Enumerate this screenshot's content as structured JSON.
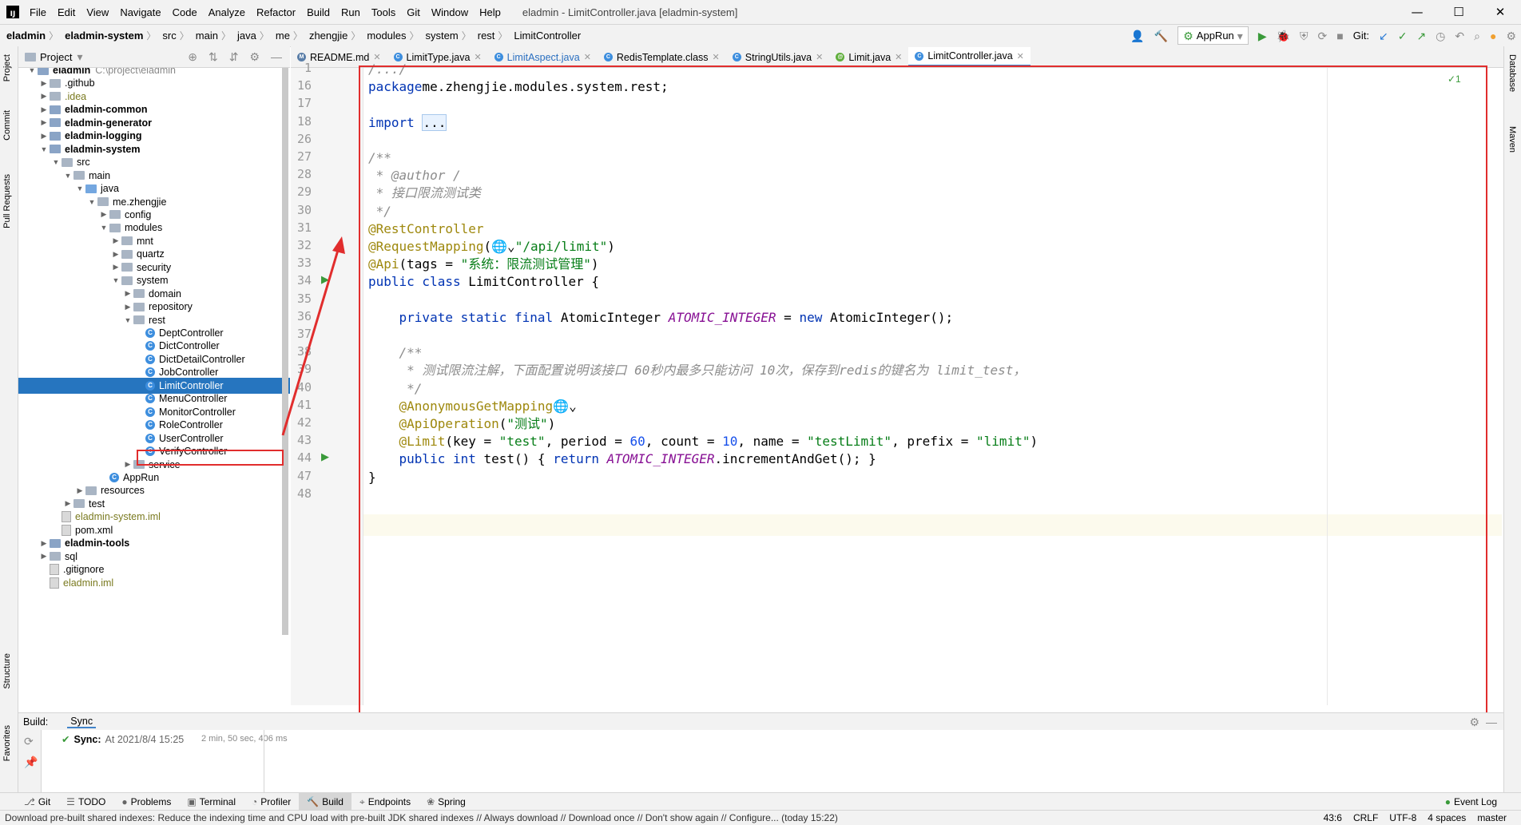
{
  "window": {
    "logo": "IJ",
    "menu": [
      "File",
      "Edit",
      "View",
      "Navigate",
      "Code",
      "Analyze",
      "Refactor",
      "Build",
      "Run",
      "Tools",
      "Git",
      "Window",
      "Help"
    ],
    "title": "eladmin - LimitController.java [eladmin-system]",
    "controls": [
      "—",
      "☐",
      "✕"
    ]
  },
  "breadcrumb": [
    "eladmin",
    "eladmin-system",
    "src",
    "main",
    "java",
    "me",
    "zhengjie",
    "modules",
    "system",
    "rest",
    "LimitController"
  ],
  "toolbar": {
    "run_config": "AppRun",
    "git_label": "Git:"
  },
  "left_stripe": [
    "Project",
    "Commit",
    "Pull Requests",
    "Structure",
    "Favorites"
  ],
  "right_stripe": [
    "Database",
    "Maven"
  ],
  "project": {
    "header": "Project",
    "tree": [
      {
        "indent": 0,
        "arrow": "▼",
        "icon": "module",
        "text": "eladmin",
        "suffix": "C:\\project\\eladmin",
        "bold": true
      },
      {
        "indent": 1,
        "arrow": "▶",
        "icon": "folder",
        "text": ".github"
      },
      {
        "indent": 1,
        "arrow": "▶",
        "icon": "folder",
        "text": ".idea",
        "style": "olive"
      },
      {
        "indent": 1,
        "arrow": "▶",
        "icon": "module",
        "text": "eladmin-common",
        "bold": true
      },
      {
        "indent": 1,
        "arrow": "▶",
        "icon": "module",
        "text": "eladmin-generator",
        "bold": true
      },
      {
        "indent": 1,
        "arrow": "▶",
        "icon": "module",
        "text": "eladmin-logging",
        "bold": true
      },
      {
        "indent": 1,
        "arrow": "▼",
        "icon": "module",
        "text": "eladmin-system",
        "bold": true
      },
      {
        "indent": 2,
        "arrow": "▼",
        "icon": "folder",
        "text": "src"
      },
      {
        "indent": 3,
        "arrow": "▼",
        "icon": "folder",
        "text": "main"
      },
      {
        "indent": 4,
        "arrow": "▼",
        "icon": "blue",
        "text": "java"
      },
      {
        "indent": 5,
        "arrow": "▼",
        "icon": "folder",
        "text": "me.zhengjie"
      },
      {
        "indent": 6,
        "arrow": "▶",
        "icon": "folder",
        "text": "config"
      },
      {
        "indent": 6,
        "arrow": "▼",
        "icon": "folder",
        "text": "modules"
      },
      {
        "indent": 7,
        "arrow": "▶",
        "icon": "folder",
        "text": "mnt"
      },
      {
        "indent": 7,
        "arrow": "▶",
        "icon": "folder",
        "text": "quartz"
      },
      {
        "indent": 7,
        "arrow": "▶",
        "icon": "folder",
        "text": "security"
      },
      {
        "indent": 7,
        "arrow": "▼",
        "icon": "folder",
        "text": "system"
      },
      {
        "indent": 8,
        "arrow": "▶",
        "icon": "folder",
        "text": "domain"
      },
      {
        "indent": 8,
        "arrow": "▶",
        "icon": "folder",
        "text": "repository"
      },
      {
        "indent": 8,
        "arrow": "▼",
        "icon": "folder",
        "text": "rest"
      },
      {
        "indent": 9,
        "arrow": "",
        "icon": "class",
        "text": "DeptController"
      },
      {
        "indent": 9,
        "arrow": "",
        "icon": "class",
        "text": "DictController"
      },
      {
        "indent": 9,
        "arrow": "",
        "icon": "class",
        "text": "DictDetailController"
      },
      {
        "indent": 9,
        "arrow": "",
        "icon": "class",
        "text": "JobController"
      },
      {
        "indent": 9,
        "arrow": "",
        "icon": "class",
        "text": "LimitController",
        "selected": true
      },
      {
        "indent": 9,
        "arrow": "",
        "icon": "class",
        "text": "MenuController"
      },
      {
        "indent": 9,
        "arrow": "",
        "icon": "class",
        "text": "MonitorController"
      },
      {
        "indent": 9,
        "arrow": "",
        "icon": "class",
        "text": "RoleController"
      },
      {
        "indent": 9,
        "arrow": "",
        "icon": "class",
        "text": "UserController"
      },
      {
        "indent": 9,
        "arrow": "",
        "icon": "class",
        "text": "VerifyController"
      },
      {
        "indent": 8,
        "arrow": "▶",
        "icon": "folder",
        "text": "service"
      },
      {
        "indent": 6,
        "arrow": "",
        "icon": "class",
        "text": "AppRun"
      },
      {
        "indent": 4,
        "arrow": "▶",
        "icon": "folder",
        "text": "resources"
      },
      {
        "indent": 3,
        "arrow": "▶",
        "icon": "folder",
        "text": "test"
      },
      {
        "indent": 2,
        "arrow": "",
        "icon": "file",
        "text": "eladmin-system.iml",
        "style": "olive"
      },
      {
        "indent": 2,
        "arrow": "",
        "icon": "file",
        "text": "pom.xml"
      },
      {
        "indent": 1,
        "arrow": "▶",
        "icon": "module",
        "text": "eladmin-tools",
        "bold": true
      },
      {
        "indent": 1,
        "arrow": "▶",
        "icon": "folder",
        "text": "sql"
      },
      {
        "indent": 1,
        "arrow": "",
        "icon": "file",
        "text": ".gitignore"
      },
      {
        "indent": 1,
        "arrow": "",
        "icon": "file",
        "text": "eladmin.iml",
        "style": "olive"
      }
    ]
  },
  "tabs": [
    {
      "label": "README.md",
      "icon": "md",
      "color": "#5a7ea8"
    },
    {
      "label": "LimitType.java",
      "icon": "class",
      "color": "#3d8ede"
    },
    {
      "label": "LimitAspect.java",
      "icon": "class",
      "color": "#3d8ede",
      "style": "blue"
    },
    {
      "label": "RedisTemplate.class",
      "icon": "class",
      "color": "#3d8ede"
    },
    {
      "label": "StringUtils.java",
      "icon": "class",
      "color": "#3d8ede"
    },
    {
      "label": "Limit.java",
      "icon": "annotation",
      "color": "#5fae3b"
    },
    {
      "label": "LimitController.java",
      "icon": "class",
      "color": "#3d8ede",
      "active": true
    }
  ],
  "editor": {
    "inspection": "✓1",
    "lines": [
      {
        "n": "1",
        "tokens": [
          [
            "cmt",
            "/.../"
          ]
        ]
      },
      {
        "n": "16",
        "tokens": [
          [
            "kw",
            "package"
          ],
          [
            "",
            "me.zhengjie.modules.system.rest;"
          ]
        ]
      },
      {
        "n": "17",
        "tokens": []
      },
      {
        "n": "18",
        "tokens": [
          [
            "kw",
            "import"
          ],
          [
            "",
            ""
          ],
          [
            "fold",
            "..."
          ]
        ]
      },
      {
        "n": "26",
        "tokens": []
      },
      {
        "n": "27",
        "tokens": [
          [
            "cmt",
            "/**"
          ]
        ]
      },
      {
        "n": "28",
        "tokens": [
          [
            "cmt",
            " * @author /"
          ]
        ]
      },
      {
        "n": "29",
        "tokens": [
          [
            "cmt",
            " * 接口限流测试类"
          ]
        ]
      },
      {
        "n": "30",
        "tokens": [
          [
            "cmt",
            " */"
          ]
        ]
      },
      {
        "n": "31",
        "tokens": [
          [
            "ann",
            "@RestController"
          ]
        ]
      },
      {
        "n": "32",
        "tokens": [
          [
            "ann",
            "@RequestMapping"
          ],
          [
            "",
            "(🌐⌄"
          ],
          [
            "str",
            "\"/api/limit\""
          ],
          [
            "",
            ")"
          ]
        ]
      },
      {
        "n": "33",
        "tokens": [
          [
            "ann",
            "@Api"
          ],
          [
            "",
            "(tags = "
          ],
          [
            "str",
            "\"系统：限流测试管理\""
          ],
          [
            "",
            ")"
          ]
        ]
      },
      {
        "n": "34",
        "tokens": [
          [
            "kw",
            "public class"
          ],
          [
            "",
            " LimitController {"
          ]
        ]
      },
      {
        "n": "35",
        "tokens": []
      },
      {
        "n": "36",
        "tokens": [
          [
            "",
            "    "
          ],
          [
            "kw",
            "private static final"
          ],
          [
            "",
            " AtomicInteger "
          ],
          [
            "const",
            "ATOMIC_INTEGER"
          ],
          [
            "",
            " = "
          ],
          [
            "kw",
            "new"
          ],
          [
            "",
            " AtomicInteger();"
          ]
        ]
      },
      {
        "n": "37",
        "tokens": []
      },
      {
        "n": "38",
        "tokens": [
          [
            "",
            "    "
          ],
          [
            "cmt",
            "/**"
          ]
        ]
      },
      {
        "n": "39",
        "tokens": [
          [
            "",
            "    "
          ],
          [
            "cmt",
            " * 测试限流注解，下面配置说明该接口 60秒内最多只能访问 10次，保存到redis的键名为 limit_test，"
          ]
        ]
      },
      {
        "n": "40",
        "tokens": [
          [
            "",
            "    "
          ],
          [
            "cmt",
            " */"
          ]
        ]
      },
      {
        "n": "41",
        "tokens": [
          [
            "",
            "    "
          ],
          [
            "ann",
            "@AnonymousGetMapping"
          ],
          [
            "",
            "🌐⌄"
          ]
        ]
      },
      {
        "n": "42",
        "tokens": [
          [
            "",
            "    "
          ],
          [
            "ann",
            "@ApiOperation"
          ],
          [
            "",
            "("
          ],
          [
            "str",
            "\"测试\""
          ],
          [
            "",
            ")"
          ]
        ]
      },
      {
        "n": "43",
        "tokens": [
          [
            "",
            "    "
          ],
          [
            "ann",
            "@Limit"
          ],
          [
            "",
            "(key = "
          ],
          [
            "str",
            "\"test\""
          ],
          [
            "",
            ", period = "
          ],
          [
            "num",
            "60"
          ],
          [
            "",
            ", count = "
          ],
          [
            "num",
            "10"
          ],
          [
            "",
            ", name = "
          ],
          [
            "str",
            "\"testLimit\""
          ],
          [
            "",
            ", prefix = "
          ],
          [
            "str",
            "\"limit\""
          ],
          [
            "",
            ")"
          ]
        ]
      },
      {
        "n": "44",
        "tokens": [
          [
            "",
            "    "
          ],
          [
            "kw",
            "public int"
          ],
          [
            "",
            " test() { "
          ],
          [
            "kw",
            "return"
          ],
          [
            "",
            " "
          ],
          [
            "const",
            "ATOMIC_INTEGER"
          ],
          [
            "",
            ".incrementAndGet(); }"
          ]
        ]
      },
      {
        "n": "47",
        "tokens": [
          [
            "",
            "}"
          ]
        ]
      },
      {
        "n": "48",
        "tokens": []
      }
    ]
  },
  "build": {
    "label": "Build:",
    "tab": "Sync",
    "sync_label": "Sync:",
    "sync_time": "At 2021/8/4 15:25",
    "duration": "2 min, 50 sec, 406 ms"
  },
  "toolwindows": [
    "Git",
    "TODO",
    "Problems",
    "Terminal",
    "Profiler",
    "Build",
    "Endpoints",
    "Spring"
  ],
  "event_log": "Event Log",
  "status": {
    "message": "Download pre-built shared indexes: Reduce the indexing time and CPU load with pre-built JDK shared indexes // Always download // Download once // Don't show again // Configure... (today 15:22)",
    "position": "43:6",
    "line_sep": "CRLF",
    "encoding": "UTF-8",
    "indent": "4 spaces",
    "branch": "master"
  }
}
